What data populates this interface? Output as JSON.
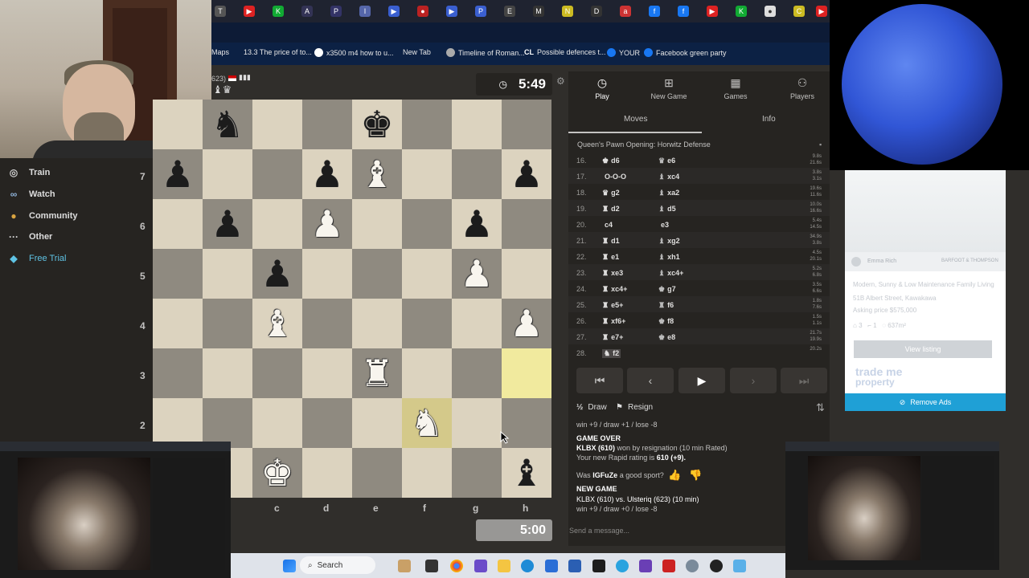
{
  "browser": {
    "bookmarks": [
      {
        "label": "Maps"
      },
      {
        "label": "13.3 The price of to..."
      },
      {
        "label": "x3500 m4 how to u..."
      },
      {
        "label": "New Tab"
      },
      {
        "label": "Timeline of Roman..."
      },
      {
        "label": "Possible defences t..."
      },
      {
        "label": "YOUR"
      },
      {
        "label": "Facebook green party"
      }
    ]
  },
  "sidebar": {
    "items": [
      {
        "label": "Train",
        "icon": "target-icon"
      },
      {
        "label": "Watch",
        "icon": "binoculars-icon"
      },
      {
        "label": "Community",
        "icon": "community-icon"
      },
      {
        "label": "Other",
        "icon": "more-icon"
      },
      {
        "label": "Free Trial",
        "icon": "diamond-icon"
      }
    ]
  },
  "game": {
    "opponent_rating_fragment": "623)",
    "top_clock": "5:49",
    "bottom_clock": "5:00",
    "ranks": [
      "7",
      "6",
      "5",
      "4",
      "3",
      "2"
    ],
    "files": [
      "c",
      "d",
      "e",
      "f",
      "g",
      "h"
    ],
    "board": [
      [
        "",
        "bn",
        "",
        "",
        "bk",
        "",
        "",
        ""
      ],
      [
        "bp",
        "",
        "",
        "bp",
        "wb",
        "",
        "",
        "bp"
      ],
      [
        "",
        "bp",
        "",
        "wp",
        "",
        "",
        "bp",
        ""
      ],
      [
        "",
        "",
        "bp",
        "",
        "",
        "",
        "wp",
        ""
      ],
      [
        "",
        "",
        "wb",
        "",
        "",
        "",
        "",
        "wp"
      ],
      [
        "",
        "",
        "",
        "",
        "wr",
        "",
        "",
        ""
      ],
      [
        "",
        "",
        "",
        "",
        "",
        "wn",
        "",
        ""
      ],
      [
        "",
        "",
        "wk",
        "",
        "",
        "",
        "",
        "bb"
      ]
    ],
    "highlighted_squares": [
      "h3",
      "f2"
    ]
  },
  "panel": {
    "tabs": [
      {
        "label": "Play",
        "icon": "clock-icon"
      },
      {
        "label": "New Game",
        "icon": "plus-icon"
      },
      {
        "label": "Games",
        "icon": "board-icon"
      },
      {
        "label": "Players",
        "icon": "players-icon"
      }
    ],
    "subtabs": {
      "moves": "Moves",
      "info": "Info"
    },
    "opening": "Queen's Pawn Opening: Horwitz Defense",
    "moves": [
      {
        "no": "16.",
        "white": "d6",
        "black": "e6",
        "t1": "9.8s",
        "t2": "21.6s"
      },
      {
        "no": "17.",
        "white": "O-O-O",
        "black": "xc4",
        "t1": "3.8s",
        "t2": "3.1s"
      },
      {
        "no": "18.",
        "white": "g2",
        "black": "xa2",
        "t1": "19.6s",
        "t2": "11.6s"
      },
      {
        "no": "19.",
        "white": "d2",
        "black": "d5",
        "t1": "10.0s",
        "t2": "16.6s"
      },
      {
        "no": "20.",
        "white": "c4",
        "black": "e3",
        "t1": "5.4s",
        "t2": "14.5s"
      },
      {
        "no": "21.",
        "white": "d1",
        "black": "xg2",
        "t1": "34.9s",
        "t2": "3.8s"
      },
      {
        "no": "22.",
        "white": "e1",
        "black": "xh1",
        "t1": "4.5s",
        "t2": "20.1s"
      },
      {
        "no": "23.",
        "white": "xe3",
        "black": "xc4+",
        "t1": "5.2s",
        "t2": "6.8s"
      },
      {
        "no": "24.",
        "white": "xc4+",
        "black": "g7",
        "t1": "3.5s",
        "t2": "6.6s"
      },
      {
        "no": "25.",
        "white": "e5+",
        "black": "f6",
        "t1": "1.8s",
        "t2": "7.6s"
      },
      {
        "no": "26.",
        "white": "xf6+",
        "black": "f8",
        "t1": "1.5s",
        "t2": "1.1s"
      },
      {
        "no": "27.",
        "white": "e7+",
        "black": "e8",
        "t1": "21.7s",
        "t2": "19.9s"
      },
      {
        "no": "28.",
        "white": "f2",
        "black": "",
        "t1": "20.2s",
        "t2": ""
      }
    ],
    "draw_label": "Draw",
    "resign_label": "Resign",
    "messages": {
      "prev_result": "win +9 / draw +1 / lose -8",
      "game_over": "GAME OVER",
      "winner_line": "won by resignation (10 min Rated)",
      "winner_name": "KLBX (610)",
      "rating_line_prefix": "Your new Rapid rating is",
      "rating_value": "610 (+9).",
      "sport_prefix": "Was",
      "sport_name": "IGFuZe",
      "sport_suffix": "a good sport?",
      "new_game": "NEW GAME",
      "new_game_line": "KLBX (610) vs. Ulsteriq (623) (10 min)",
      "new_game_result": "win +9 / draw +0 / lose -8"
    },
    "chat_placeholder": "Send a message..."
  },
  "ad": {
    "agent": "Emma Rich",
    "brand": "BARFOOT & THOMPSON",
    "title": "Modern, Sunny & Low Maintenance Family Living",
    "address": "51B Albert Street, Kawakawa",
    "price": "Asking price $575,000",
    "beds": "3",
    "baths": "1",
    "area": "637m²",
    "view_listing": "View listing",
    "trademe": "trade me",
    "trademe2": "property",
    "remove_ads": "Remove Ads"
  },
  "taskbar": {
    "search": "Search"
  },
  "colors": {
    "light_square": "#dcd3bf",
    "dark_square": "#8f8a80",
    "highlight": "#f1ea9e",
    "panel": "#262421",
    "accent": "#1fa0d6"
  }
}
